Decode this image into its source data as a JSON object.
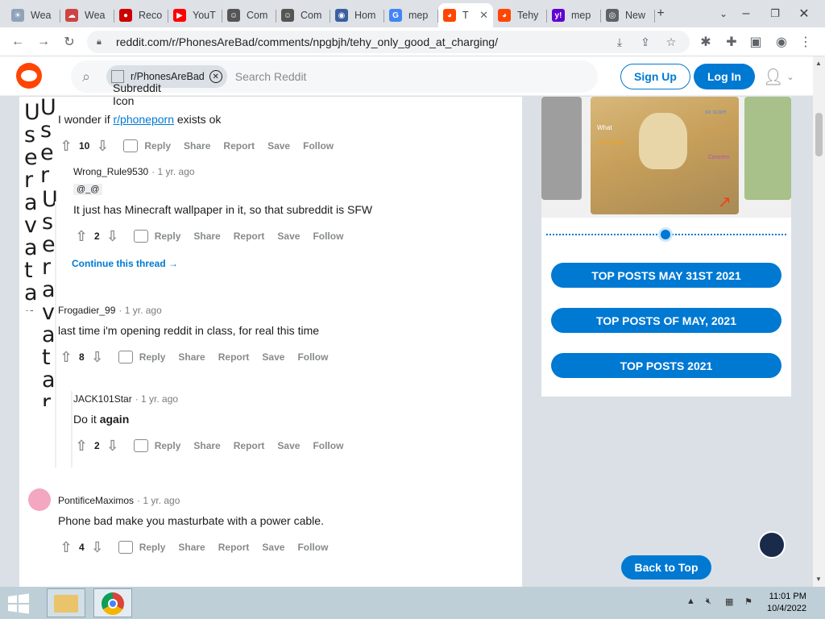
{
  "browser": {
    "tabs": [
      {
        "label": "Wea",
        "fav_color": "#8fa3b8",
        "fav_glyph": "☀"
      },
      {
        "label": "Wea",
        "fav_color": "#c44",
        "fav_glyph": "☁"
      },
      {
        "label": "Reco",
        "fav_color": "#c00",
        "fav_glyph": "●"
      },
      {
        "label": "YouT",
        "fav_color": "#f00",
        "fav_glyph": "▶"
      },
      {
        "label": "Com",
        "fav_color": "#555",
        "fav_glyph": "☺"
      },
      {
        "label": "Com",
        "fav_color": "#555",
        "fav_glyph": "☺"
      },
      {
        "label": "Hom",
        "fav_color": "#3a5fa0",
        "fav_glyph": "◉"
      },
      {
        "label": "mep",
        "fav_color": "#4285f4",
        "fav_glyph": "G"
      },
      {
        "label": "T",
        "fav_color": "#ff4500",
        "fav_glyph": "◕",
        "active": true
      },
      {
        "label": "Tehy",
        "fav_color": "#ff4500",
        "fav_glyph": "◕"
      },
      {
        "label": "mep",
        "fav_color": "#6001d2",
        "fav_glyph": "y!"
      },
      {
        "label": "New",
        "fav_color": "#5f6368",
        "fav_glyph": "◎"
      }
    ],
    "url": "reddit.com/r/PhonesAreBad/comments/npgbjh/tehy_only_good_at_charging/"
  },
  "header": {
    "subreddit_chip": "r/PhonesAreBad",
    "subreddit_icon_alt": "Subreddit Icon",
    "search_placeholder": "Search Reddit",
    "signup_label": "Sign Up",
    "login_label": "Log In"
  },
  "comments": [
    {
      "author": "",
      "time": "",
      "body_prefix": "I wonder if ",
      "body_link": "r/phoneporn",
      "body_suffix": " exists ok",
      "votes": "10"
    },
    {
      "author": "Wrong_Rule9530",
      "time": "1 yr. ago",
      "flair": "@_@",
      "body": "It just has Minecraft wallpaper in it, so that subreddit is SFW",
      "votes": "2"
    },
    {
      "author": "Frogadier_99",
      "time": "1 yr. ago",
      "body": "last time i'm opening reddit in class, for real this time",
      "votes": "8"
    },
    {
      "author": "JACK101Star",
      "time": "1 yr. ago",
      "body_plain": "Do it ",
      "body_bold": "again",
      "votes": "2"
    },
    {
      "author": "PontificeMaximos",
      "time": "1 yr. ago",
      "body": "Phone bad make you masturbate with a power cable.",
      "votes": "4"
    }
  ],
  "actions": {
    "reply": "Reply",
    "share": "Share",
    "report": "Report",
    "save": "Save",
    "follow": "Follow"
  },
  "continue_thread": "Continue this thread",
  "broken_avatar_text": "User avatar",
  "sidebar": {
    "meme_text": [
      "What",
      "you doing",
      "so scare",
      "Concern"
    ],
    "buttons": [
      "TOP POSTS MAY 31ST 2021",
      "TOP POSTS OF MAY, 2021",
      "TOP POSTS 2021"
    ]
  },
  "back_to_top": "Back to Top",
  "taskbar": {
    "time": "11:01 PM",
    "date": "10/4/2022"
  },
  "colors": {
    "reddit_orange": "#ff4500",
    "reddit_blue": "#0079d3"
  }
}
